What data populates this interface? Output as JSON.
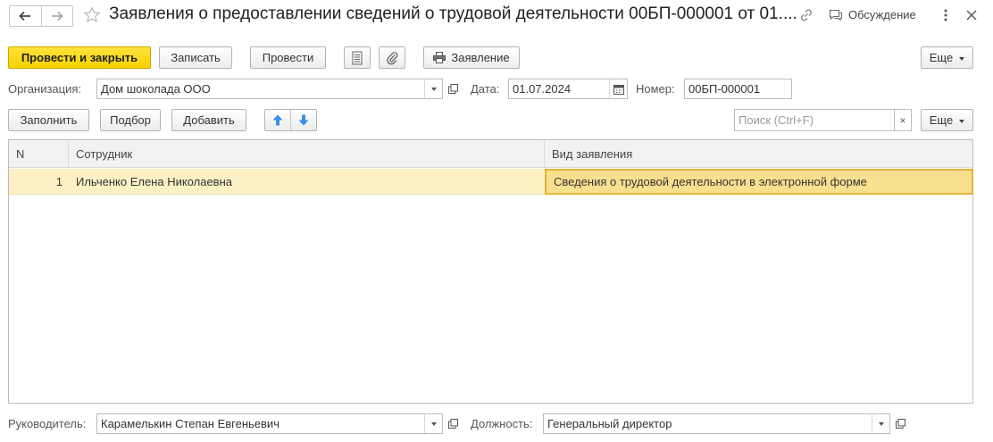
{
  "header": {
    "title": "Заявления о предоставлении сведений о трудовой деятельности 00БП-000001 от 01....",
    "discuss_label": "Обсуждение"
  },
  "toolbar": {
    "post_close_label": "Провести и закрыть",
    "save_label": "Записать",
    "post_label": "Провести",
    "statement_label": "Заявление",
    "more_label": "Еще"
  },
  "form": {
    "org_label": "Организация:",
    "org_value": "Дом шоколада ООО",
    "date_label": "Дата:",
    "date_value": "01.07.2024",
    "number_label": "Номер:",
    "number_value": "00БП-000001"
  },
  "table_toolbar": {
    "fill_label": "Заполнить",
    "pick_label": "Подбор",
    "add_label": "Добавить",
    "search_placeholder": "Поиск (Ctrl+F)",
    "clear_label": "×",
    "more_label": "Еще"
  },
  "table": {
    "columns": [
      "N",
      "Сотрудник",
      "Вид заявления"
    ],
    "rows": [
      {
        "n": "1",
        "employee": "Ильченко Елена Николаевна",
        "kind": "Сведения о трудовой деятельности в электронной форме"
      }
    ]
  },
  "footer": {
    "head_label": "Руководитель:",
    "head_value": "Карамелькин Степан Евгеньевич",
    "position_label": "Должность:",
    "position_value": "Генеральный директор"
  },
  "colors": {
    "primary_button": "#f7d200",
    "selected_row": "#fbf1c4",
    "selected_cell_border": "#e2b33c",
    "arrow_blue": "#3a8ee6"
  },
  "icons": [
    "back-arrow-icon",
    "forward-arrow-icon",
    "star-icon",
    "link-icon",
    "discussion-icon",
    "more-vertical-icon",
    "close-icon",
    "document-list-icon",
    "paperclip-icon",
    "printer-icon",
    "move-up-icon",
    "move-down-icon",
    "calendar-icon",
    "open-form-icon"
  ]
}
